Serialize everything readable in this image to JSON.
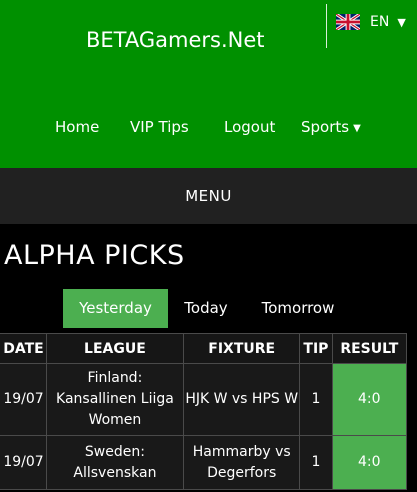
{
  "header": {
    "brand": "BETAGamers.Net",
    "language": {
      "code": "EN",
      "flag_icon": "uk-flag-icon"
    },
    "nav": [
      {
        "label": "Home"
      },
      {
        "label": "VIP Tips"
      },
      {
        "label": "Logout"
      },
      {
        "label": "Sports",
        "icon": "caret-down-icon"
      }
    ],
    "colors": {
      "header_bg": "#009000",
      "accent": "#4caf50",
      "menu_bg": "#212121"
    }
  },
  "menu": {
    "label": "MENU"
  },
  "page": {
    "title": "ALPHA PICKS"
  },
  "tabs": [
    {
      "label": "Yesterday",
      "active": true
    },
    {
      "label": "Today",
      "active": false
    },
    {
      "label": "Tomorrow",
      "active": false
    }
  ],
  "table": {
    "headers": [
      "DATE",
      "LEAGUE",
      "FIXTURE",
      "TIP",
      "RESULT"
    ],
    "rows": [
      {
        "date": "19/07",
        "league": "Finland: Kansallinen Liiga Women",
        "fixture": "HJK W vs HPS W",
        "tip": "1",
        "result": "4:0"
      },
      {
        "date": "19/07",
        "league": "Sweden: Allsvenskan",
        "fixture": "Hammarby vs Degerfors",
        "tip": "1",
        "result": "4:0"
      }
    ]
  }
}
